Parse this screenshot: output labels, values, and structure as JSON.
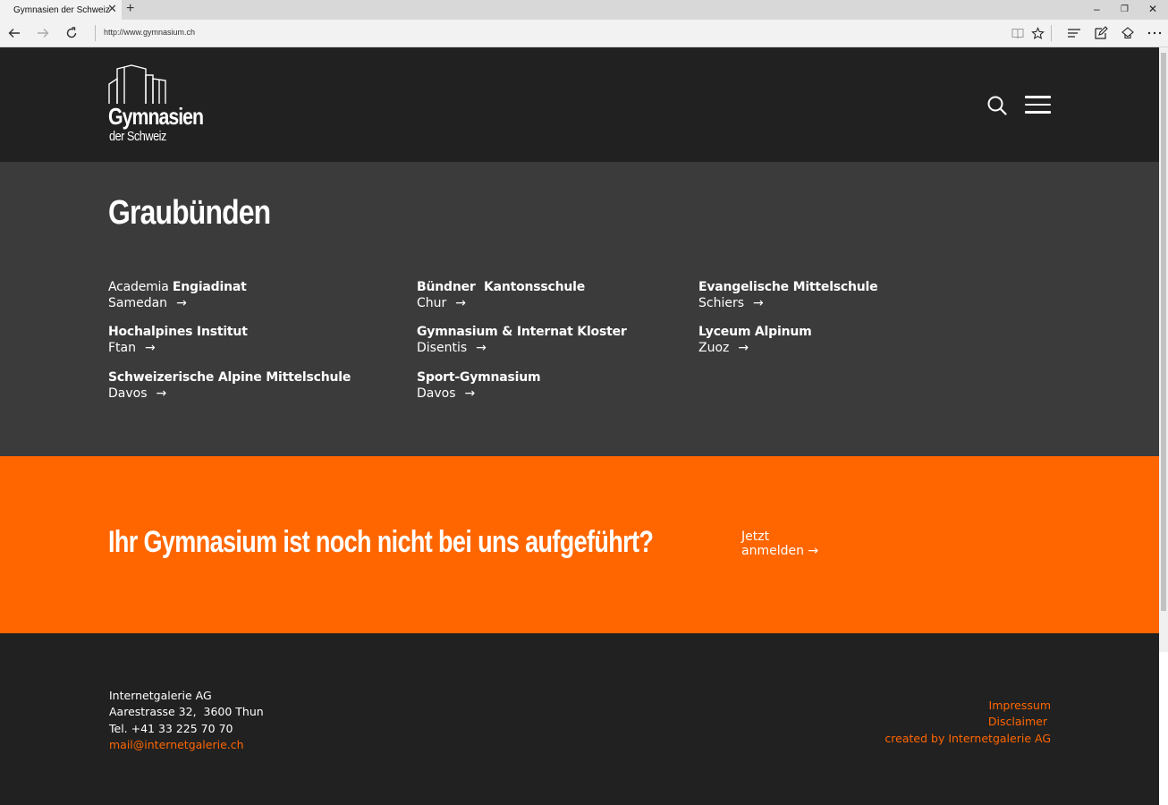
{
  "browser": {
    "tab_title": "Gymnasien der Schweiz",
    "tab_close": "✕",
    "new_tab": "+",
    "url": "http://www.gymnasium.ch",
    "window_controls": [
      "–",
      "❐",
      "✕"
    ]
  },
  "header": {
    "logo_line1": "Gymnasien",
    "logo_line2": "der Schweiz",
    "icons": [
      "search-icon",
      "hamburger-menu-icon"
    ]
  },
  "region": {
    "title": "Graubünden",
    "schools": [
      {
        "name_light": "Academia ",
        "name": "Engiadinat",
        "location": "Samedan"
      },
      {
        "name_light": "",
        "name": "Bündner  Kantonsschule",
        "location": "Chur"
      },
      {
        "name_light": "",
        "name": "Evangelische Mittelschule",
        "location": "Schiers"
      },
      {
        "name_light": "",
        "name": "Hochalpines Institut",
        "location": "Ftan"
      },
      {
        "name_light": "",
        "name": "Gymnasium & Internat Kloster",
        "location": "Disentis"
      },
      {
        "name_light": "",
        "name": "Lyceum Alpinum",
        "location": "Zuoz"
      },
      {
        "name_light": "",
        "name": "Schweizerische Alpine Mittelschule",
        "location": "Davos"
      },
      {
        "name_light": "",
        "name": "Sport-Gymnasium",
        "location": "Davos"
      }
    ],
    "arrow": "→"
  },
  "cta": {
    "text": "Ihr Gymnasium ist noch nicht bei uns aufgeführt?",
    "link_line1": "Jetzt",
    "link_line2": "anmelden →"
  },
  "footer": {
    "company": "Internetgalerie AG",
    "street": "Aarestrasse 32,  3600 Thun",
    "phone": "Tel. +41 33 225 70 70",
    "email": "mail@internetgalerie.ch",
    "links": [
      "Impressum",
      "Disclaimer ",
      "created by Internetgalerie AG"
    ]
  },
  "colors": {
    "header_bg": "#212121",
    "region_bg": "#3b3b3b",
    "accent": "#ff6600",
    "text": "#ffffff"
  }
}
